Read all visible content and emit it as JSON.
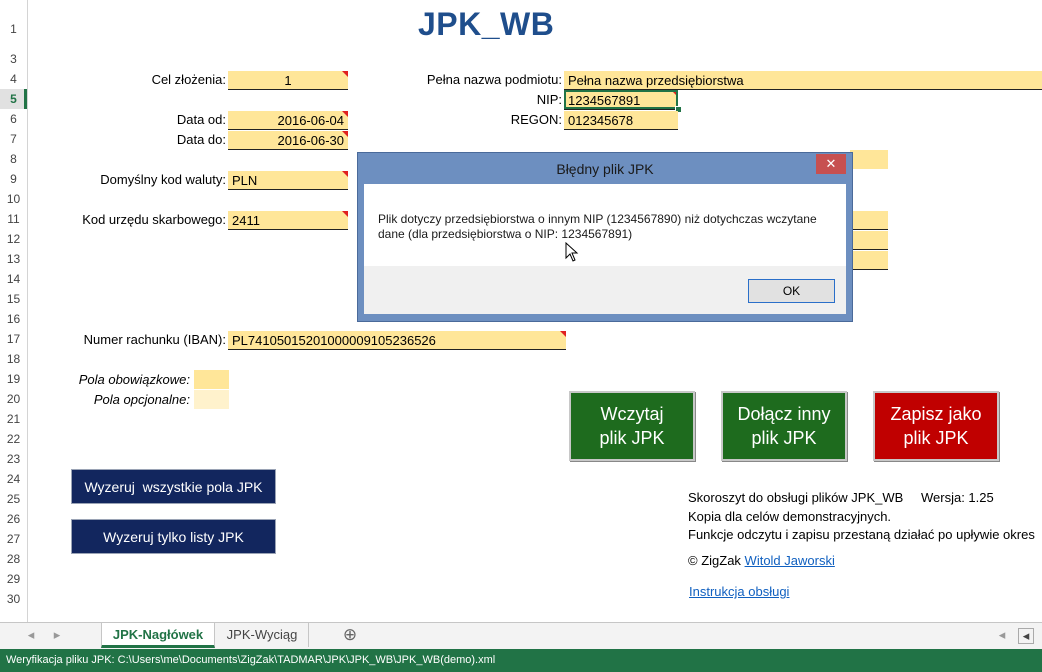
{
  "title": "JPK_WB",
  "rows": [
    "1",
    "3",
    "4",
    "5",
    "6",
    "7",
    "8",
    "9",
    "10",
    "11",
    "12",
    "13",
    "14",
    "15",
    "16",
    "17",
    "18",
    "19",
    "20",
    "21",
    "22",
    "23",
    "24",
    "25",
    "26",
    "27",
    "28",
    "29",
    "30"
  ],
  "fields_left": {
    "cel_label": "Cel złożenia:",
    "cel_value": "1",
    "data_od_label": "Data od:",
    "data_od_value": "2016-06-04",
    "data_do_label": "Data do:",
    "data_do_value": "2016-06-30",
    "waluta_label": "Domyślny kod waluty:",
    "waluta_value": "PLN",
    "urzad_label": "Kod urzędu skarbowego:",
    "urzad_value": "2411",
    "iban_label": "Numer rachunku (IBAN):",
    "iban_value": "PL74105015201000009105236526"
  },
  "fields_right": {
    "nazwa_label": "Pełna nazwa podmiotu:",
    "nazwa_value": "Pełna nazwa przedsiębiorstwa",
    "nip_label": "NIP:",
    "nip_value": "1234567891",
    "regon_label": "REGON:",
    "regon_value": "012345678"
  },
  "legend": {
    "required": "Pola obowiązkowe:",
    "optional": "Pola opcjonalne:"
  },
  "buttons": {
    "load": "Wczytaj\nplik JPK",
    "append": "Dołącz inny\nplik JPK",
    "save": "Zapisz jako\nplik JPK",
    "reset_all": "Wyzeruj  wszystkie pola JPK",
    "reset_lists": "Wyzeruj tylko listy JPK"
  },
  "info": {
    "line1": "Skoroszyt do obsługi plików JPK_WB",
    "version": "Wersja: 1.25",
    "line2": "Kopia dla celów demonstracyjnych.",
    "line3": "Funkcje odczytu i zapisu przestaną działać po upływie okres",
    "copyright": "© ZigZak",
    "author": "Witold Jaworski",
    "manual": "Instrukcja obsługi"
  },
  "dialog": {
    "title": "Błędny plik JPK",
    "close": "✕",
    "message": "Plik dotyczy przedsiębiorstwa o innym NIP (1234567890) niż dotychczas wczytane dane (dla przedsiębiorstwa o NIP: 1234567891)",
    "ok": "OK"
  },
  "tabs": {
    "active": "JPK-Nagłówek",
    "other": "JPK-Wyciąg",
    "add": "⊕",
    "prev": "◂",
    "next": "▸"
  },
  "status": "Weryfikacja pliku JPK: C:\\Users\\me\\Documents\\ZigZak\\TADMAR\\JPK\\JPK_WB\\JPK_WB(demo).xml",
  "colors": {
    "required": "#ffe699",
    "optional": "#fff2cc",
    "green": "#1e6b1e",
    "red": "#c00000",
    "navy": "#12265e",
    "excel": "#217346"
  }
}
